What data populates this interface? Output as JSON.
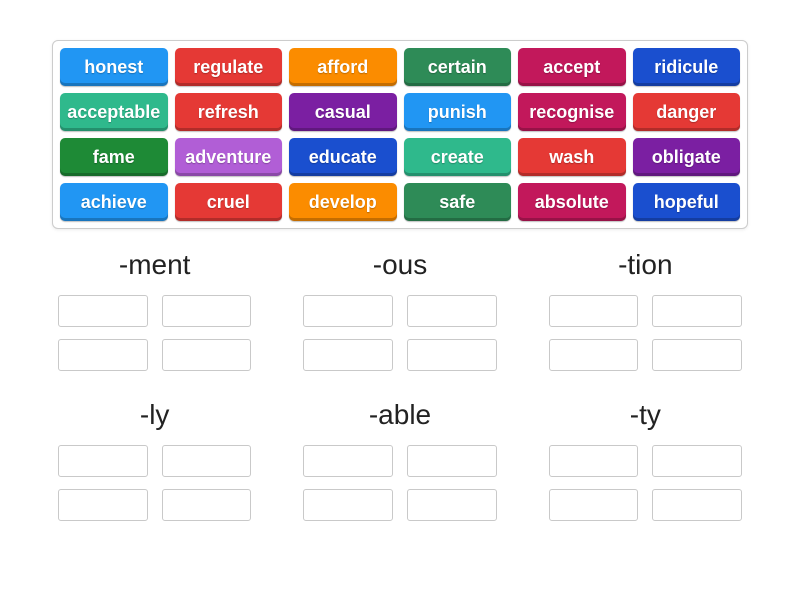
{
  "colors": {
    "blue": "#2196f3",
    "red": "#e53935",
    "orange": "#fb8c00",
    "green": "#2e8b57",
    "magenta": "#c2185b",
    "indigo": "#1a4fcf",
    "teal": "#2fb98c",
    "purple": "#7b1fa2",
    "grass": "#1e8a36",
    "violet": "#b15ed6"
  },
  "word_bank": [
    {
      "label": "honest",
      "color": "blue"
    },
    {
      "label": "regulate",
      "color": "red"
    },
    {
      "label": "afford",
      "color": "orange"
    },
    {
      "label": "certain",
      "color": "green"
    },
    {
      "label": "accept",
      "color": "magenta"
    },
    {
      "label": "ridicule",
      "color": "indigo"
    },
    {
      "label": "acceptable",
      "color": "teal"
    },
    {
      "label": "refresh",
      "color": "red"
    },
    {
      "label": "casual",
      "color": "purple"
    },
    {
      "label": "punish",
      "color": "blue"
    },
    {
      "label": "recognise",
      "color": "magenta"
    },
    {
      "label": "danger",
      "color": "red"
    },
    {
      "label": "fame",
      "color": "grass"
    },
    {
      "label": "adventure",
      "color": "violet"
    },
    {
      "label": "educate",
      "color": "indigo"
    },
    {
      "label": "create",
      "color": "teal"
    },
    {
      "label": "wash",
      "color": "red"
    },
    {
      "label": "obligate",
      "color": "purple"
    },
    {
      "label": "achieve",
      "color": "blue"
    },
    {
      "label": "cruel",
      "color": "red"
    },
    {
      "label": "develop",
      "color": "orange"
    },
    {
      "label": "safe",
      "color": "green"
    },
    {
      "label": "absolute",
      "color": "magenta"
    },
    {
      "label": "hopeful",
      "color": "indigo"
    }
  ],
  "groups": [
    {
      "title": "-ment",
      "slots": 4
    },
    {
      "title": "-ous",
      "slots": 4
    },
    {
      "title": "-tion",
      "slots": 4
    },
    {
      "title": "-ly",
      "slots": 4
    },
    {
      "title": "-able",
      "slots": 4
    },
    {
      "title": "-ty",
      "slots": 4
    }
  ]
}
